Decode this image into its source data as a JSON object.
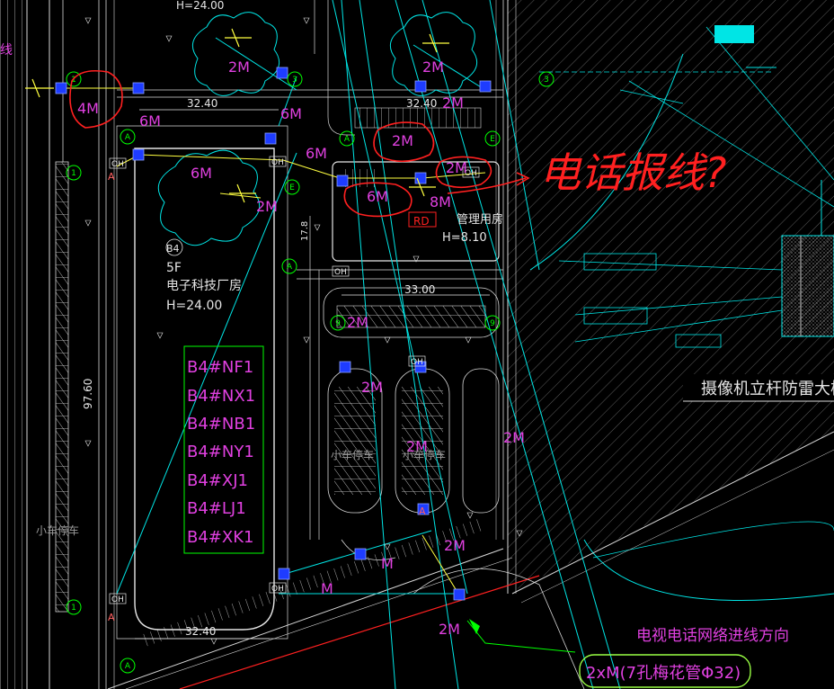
{
  "drawing": {
    "top_label_partial": "H=24.00",
    "left_edge_char": "线",
    "room_labels": [
      "4M",
      "6M",
      "6M",
      "6M",
      "2M",
      "2M",
      "2M",
      "6M",
      "2M",
      "8M",
      "2M",
      "2M",
      "2M",
      "2M",
      "2M",
      "M",
      "M",
      "2M",
      "6M",
      "2M"
    ],
    "dims": {
      "d1": "32.40",
      "d2": "32.40",
      "d3": "33.00",
      "d4": "97.60",
      "d5": "32.40",
      "d6": "17.8"
    },
    "building_b4": {
      "id": "B4",
      "floors": "5F",
      "name": "电子科技厂房",
      "height": "H=24.00"
    },
    "mgmt_building": {
      "name": "管理用房",
      "height": "H=8.10",
      "tag": "RD"
    },
    "legend_items": [
      "B4#NF1",
      "B4#NX1",
      "B4#NB1",
      "B4#NY1",
      "B4#XJ1",
      "B4#LJ1",
      "B4#XK1"
    ],
    "parking_labels": [
      "小车停车",
      "小车停车",
      "小车停车"
    ],
    "oh_label": "OH",
    "grid_A": "A",
    "grid_E": "E",
    "grid_1": "1",
    "grid_3": "3",
    "grid_9": "9",
    "handwriting": "电话报线?",
    "camera_title": "摄像机立杆防雷大样",
    "tv_direction": "电视电话网络进线方向",
    "pipe_spec": "2xM(7孔梅花管Φ32)"
  },
  "colors": {
    "background": "#000000",
    "building_line": "#e6e6e6",
    "magenta": "#e040e0",
    "cyan": "#00e5e5",
    "yellow": "#ffff40",
    "red": "#ff2020",
    "green": "#00ff00",
    "blue": "#1e3cff"
  }
}
